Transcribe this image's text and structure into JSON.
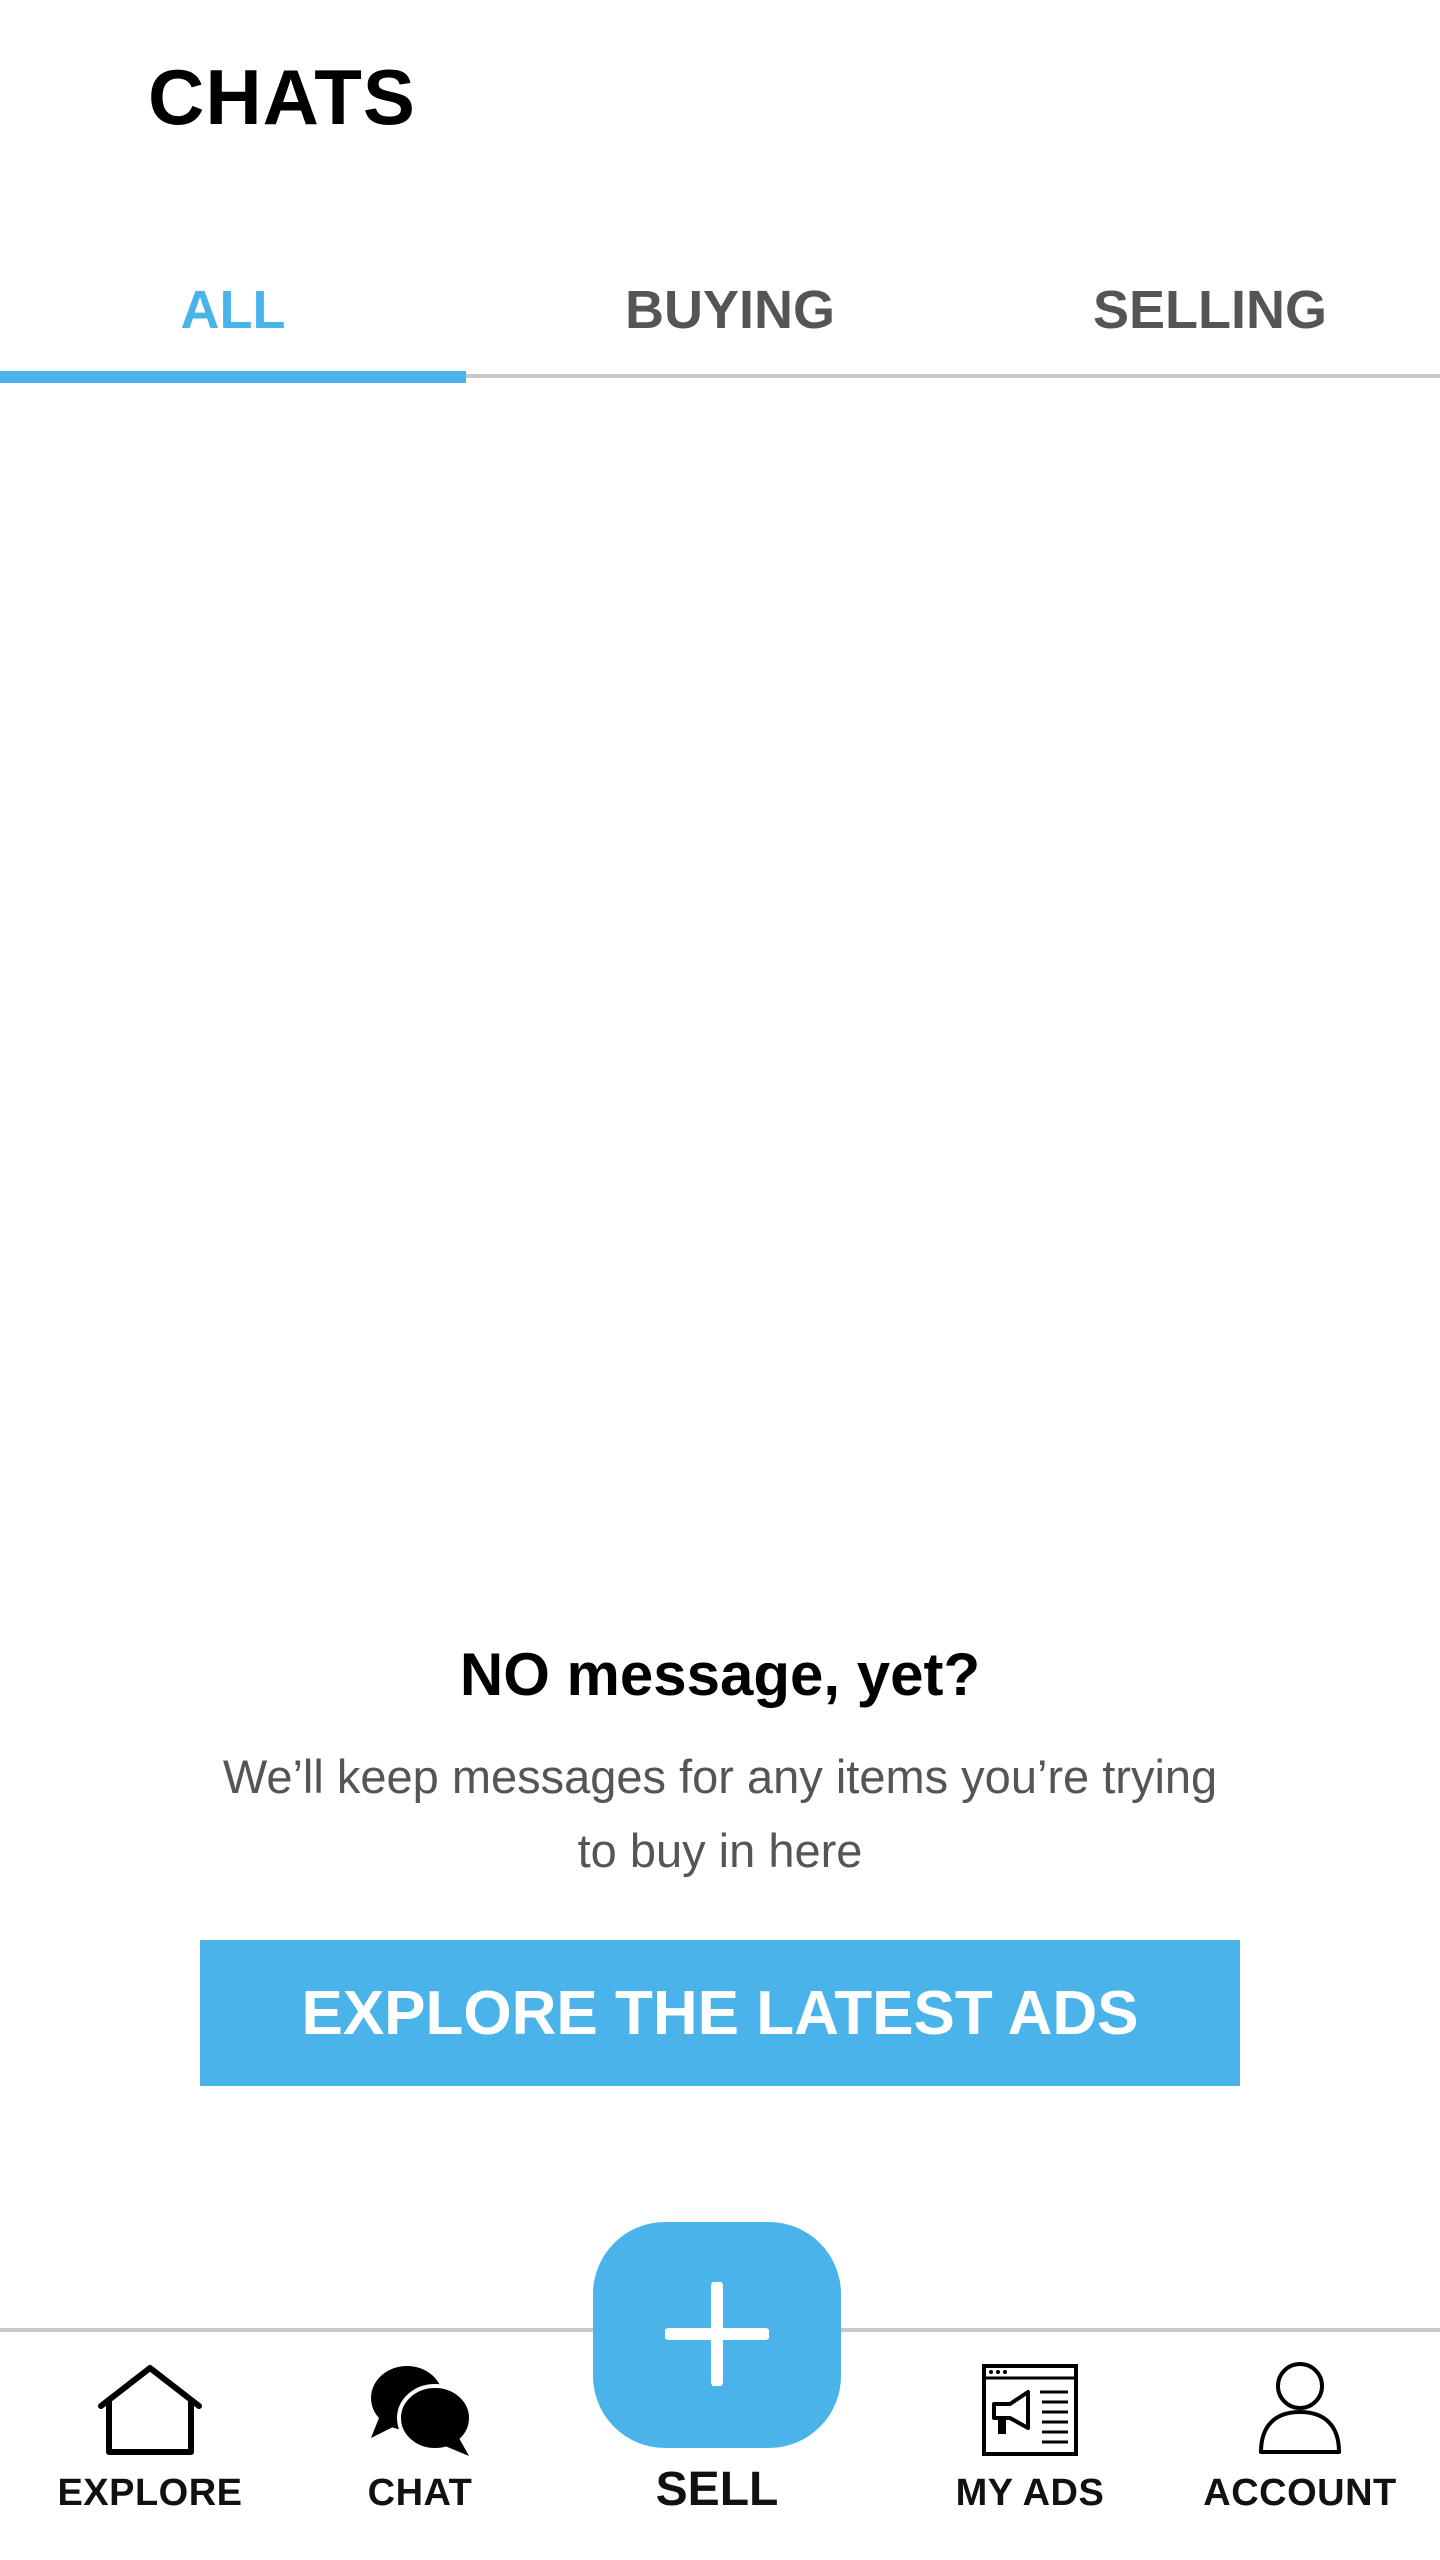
{
  "header": {
    "title": "CHATS"
  },
  "tabs": [
    {
      "label": "ALL",
      "active": true
    },
    {
      "label": "BUYING",
      "active": false
    },
    {
      "label": "SELLING",
      "active": false
    }
  ],
  "empty_state": {
    "title": "NO message, yet?",
    "description": "We’ll keep messages for any items you’re trying to buy in here",
    "cta_label": "EXPLORE THE LATEST ADS"
  },
  "bottom_nav": {
    "items": [
      {
        "label": "EXPLORE",
        "icon": "home-icon"
      },
      {
        "label": "CHAT",
        "icon": "chat-bubbles-icon"
      },
      {
        "label": "SELL",
        "icon": "plus-icon"
      },
      {
        "label": "MY ADS",
        "icon": "megaphone-ad-icon"
      },
      {
        "label": "ACCOUNT",
        "icon": "user-icon"
      }
    ]
  },
  "colors": {
    "accent": "#4ab4ea",
    "tab_inactive": "#555555",
    "divider": "#c8c8c8"
  }
}
